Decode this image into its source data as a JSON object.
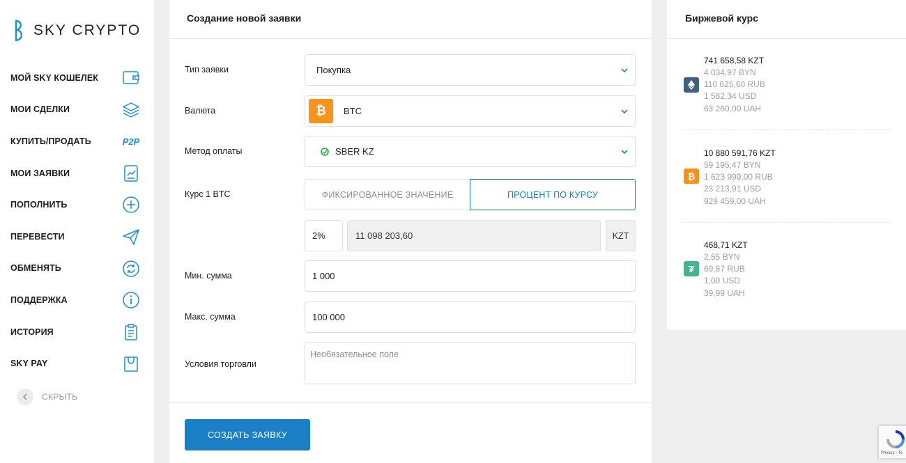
{
  "brand": {
    "name": "SKY CRYPTO"
  },
  "sidebar": {
    "items": [
      {
        "label": "МОЙ SKY КОШЕЛЕК",
        "icon": "wallet-icon"
      },
      {
        "label": "МОИ СДЕЛКИ",
        "icon": "layers-icon"
      },
      {
        "label": "КУПИТЬ/ПРОДАТЬ",
        "icon": "p2p-icon",
        "icon_text": "P2P"
      },
      {
        "label": "МОИ ЗАЯВКИ",
        "icon": "chart-doc-icon"
      },
      {
        "label": "ПОПОЛНИТЬ",
        "icon": "plus-circle-icon"
      },
      {
        "label": "ПЕРЕВЕСТИ",
        "icon": "send-icon"
      },
      {
        "label": "ОБМЕНЯТЬ",
        "icon": "exchange-icon"
      },
      {
        "label": "ПОДДЕРЖКА",
        "icon": "info-icon"
      },
      {
        "label": "ИСТОРИЯ",
        "icon": "clipboard-icon"
      },
      {
        "label": "SKY PAY",
        "icon": "bag-icon"
      }
    ],
    "hide_label": "СКРЫТЬ"
  },
  "form": {
    "title": "Создание новой заявки",
    "type_label": "Тип заявки",
    "type_value": "Покупка",
    "currency_label": "Валюта",
    "currency_value": "BTC",
    "payment_label": "Метод оплаты",
    "payment_value": "SBER KZ",
    "rate_label": "Курс 1 BTC",
    "rate_mode_fixed": "ФИКСИРОВАННОЕ ЗНАЧЕНИЕ",
    "rate_mode_percent": "ПРОЦЕНТ ПО КУРСУ",
    "percent_value": "2%",
    "rate_value": "11 098 203,60",
    "rate_currency": "KZT",
    "min_label": "Мин. сумма",
    "min_value": "1 000",
    "max_label": "Макс. сумма",
    "max_value": "100 000",
    "terms_label": "Условия торговли",
    "terms_placeholder": "Необязательное поле",
    "submit_label": "СОЗДАТЬ ЗАЯВКУ"
  },
  "exchange_rates": {
    "title": "Биржевой курс",
    "coins": [
      {
        "icon": "ethereum-icon",
        "color": "#3c6185",
        "lines": [
          "741 658,58 KZT",
          "4 034,97 BYN",
          "110 625,60 RUB",
          "1 582,34 USD",
          "63 260,00 UAH"
        ]
      },
      {
        "icon": "bitcoin-icon",
        "color": "#f7931a",
        "lines": [
          "10 880 591,76 KZT",
          "59 195,47 BYN",
          "1 623 999,00 RUB",
          "23 213,91 USD",
          "929 459,00 UAH"
        ]
      },
      {
        "icon": "tether-icon",
        "color": "#3fb68b",
        "lines": [
          "468,71 KZT",
          "2,55 BYN",
          "69,87 RUB",
          "1,00 USD",
          "39,99 UAH"
        ]
      }
    ]
  },
  "recaptcha": {
    "text": "Privacy - Te"
  },
  "colors": {
    "accent": "#1a7fc6",
    "bitcoin": "#f7931a",
    "ethereum": "#3c6185",
    "tether": "#3fb68b"
  }
}
